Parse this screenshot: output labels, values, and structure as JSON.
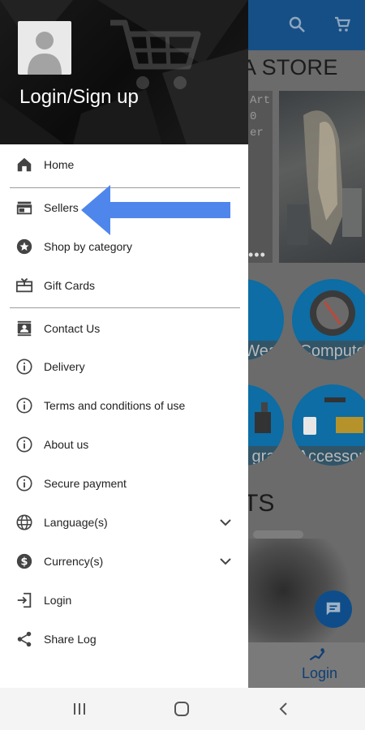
{
  "background": {
    "store_title": "A STORE",
    "banner_text": [
      "Art",
      "0",
      "er"
    ],
    "carousel_dots": "•••",
    "categories": [
      {
        "label": "Wear"
      },
      {
        "label": "Compute"
      },
      {
        "label": "gra"
      },
      {
        "label": "Accessori"
      }
    ],
    "section_title": "TS",
    "bottom_nav_login": "Login"
  },
  "drawer": {
    "header_title": "Login/Sign up",
    "items": [
      {
        "label": "Home",
        "icon": "home-icon"
      },
      {
        "label": "Sellers",
        "icon": "store-icon"
      },
      {
        "label": "Shop by category",
        "icon": "star-badge-icon"
      },
      {
        "label": "Gift Cards",
        "icon": "gift-card-icon"
      },
      {
        "label": "Contact Us",
        "icon": "contact-icon"
      },
      {
        "label": "Delivery",
        "icon": "info-icon"
      },
      {
        "label": "Terms and conditions of use",
        "icon": "info-icon"
      },
      {
        "label": "About us",
        "icon": "info-icon"
      },
      {
        "label": "Secure payment",
        "icon": "info-icon"
      },
      {
        "label": "Language(s)",
        "icon": "globe-icon"
      },
      {
        "label": "Currency(s)",
        "icon": "dollar-icon"
      },
      {
        "label": "Login",
        "icon": "login-icon"
      },
      {
        "label": "Share Log",
        "icon": "share-icon"
      }
    ]
  },
  "colors": {
    "arrow": "#4f86ec",
    "header_bg": "#111111",
    "app_bar": "#164f86"
  }
}
